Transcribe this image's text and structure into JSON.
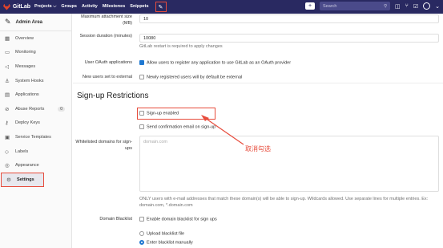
{
  "topbar": {
    "brand": "GitLab",
    "nav": [
      "Projects ⌵",
      "Groups",
      "Activity",
      "Milestones",
      "Snippets"
    ],
    "search_placeholder": "Search"
  },
  "sidebar": {
    "title": "Admin Area",
    "items": [
      {
        "label": "Overview",
        "icon": "grid-icon"
      },
      {
        "label": "Monitoring",
        "icon": "monitor-icon"
      },
      {
        "label": "Messages",
        "icon": "megaphone-icon"
      },
      {
        "label": "System Hooks",
        "icon": "hook-icon"
      },
      {
        "label": "Applications",
        "icon": "apps-icon"
      },
      {
        "label": "Abuse Reports",
        "icon": "abuse-icon",
        "count": "0"
      },
      {
        "label": "Deploy Keys",
        "icon": "key-icon"
      },
      {
        "label": "Service Templates",
        "icon": "template-icon"
      },
      {
        "label": "Labels",
        "icon": "label-icon"
      },
      {
        "label": "Appearance",
        "icon": "appearance-icon"
      },
      {
        "label": "Settings",
        "icon": "gear-icon",
        "active": true
      }
    ]
  },
  "main": {
    "max_attachment_label": "Maximum attachment size (MB)",
    "max_attachment_value": "10",
    "session_label": "Session duration (minutes)",
    "session_value": "10080",
    "session_help": "GitLab restart is required to apply changes",
    "oauth_label": "User OAuth applications",
    "oauth_text": "Allow users to register any application to use GitLab as an OAuth provider",
    "external_label": "New users set to external",
    "external_text": "Newly registered users will by default be external",
    "section_title": "Sign-up Restrictions",
    "signup_enabled": "Sign-up enabled",
    "confirm_email": "Send confirmation email on sign-up",
    "whitelist_label": "Whitelisted domains for sign-ups",
    "whitelist_placeholder": "domain.com",
    "whitelist_note": "ONLY users with e-mail addresses that match these domain(s) will be able to sign-up. Wildcards allowed. Use separate lines for multiple entries. Ex: domain.com, *.domain.com",
    "blacklist_label": "Domain Blacklist",
    "blacklist_enable": "Enable domain blacklist for sign ups",
    "upload_file": "Upload blacklist file",
    "enter_manual": "Enter blacklist manually",
    "annotation": "取消勾选"
  }
}
